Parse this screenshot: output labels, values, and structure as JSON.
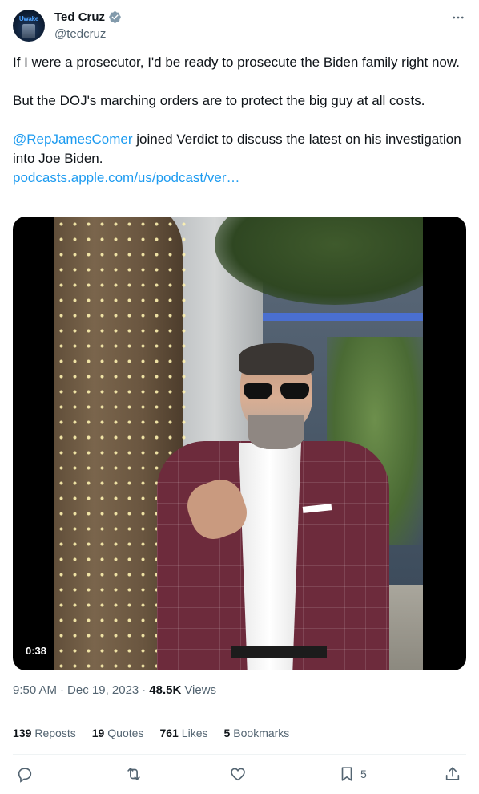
{
  "author": {
    "name": "Ted Cruz",
    "handle": "@tedcruz",
    "avatar_text": "Uwake"
  },
  "tweet": {
    "line1": "If I were a prosecutor, I'd be ready to prosecute the Biden family right now.",
    "line2": "But the DOJ's marching orders are to protect the big guy at all costs.",
    "mention": "@RepJamesComer",
    "line3_rest": " joined Verdict to discuss the latest on his investigation into Joe Biden.",
    "url": "podcasts.apple.com/us/podcast/ver…"
  },
  "video": {
    "duration": "0:38"
  },
  "meta": {
    "time": "9:50 AM",
    "sep1": "·",
    "date": "Dec 19, 2023",
    "sep2": "·",
    "views_count": "48.5K",
    "views_label": "Views"
  },
  "stats": [
    {
      "num": "139",
      "label": "Reposts"
    },
    {
      "num": "19",
      "label": "Quotes"
    },
    {
      "num": "761",
      "label": "Likes"
    },
    {
      "num": "5",
      "label": "Bookmarks"
    }
  ],
  "actions": {
    "bookmark_count": "5"
  },
  "icons": {
    "more": "more-horizontal-icon",
    "verified": "verified-badge-icon",
    "reply": "reply-icon",
    "repost": "repost-icon",
    "like": "heart-icon",
    "bookmark": "bookmark-icon",
    "share": "share-icon"
  },
  "colors": {
    "link": "#1d9bf0",
    "text": "#0f1419",
    "secondary": "#536471"
  }
}
